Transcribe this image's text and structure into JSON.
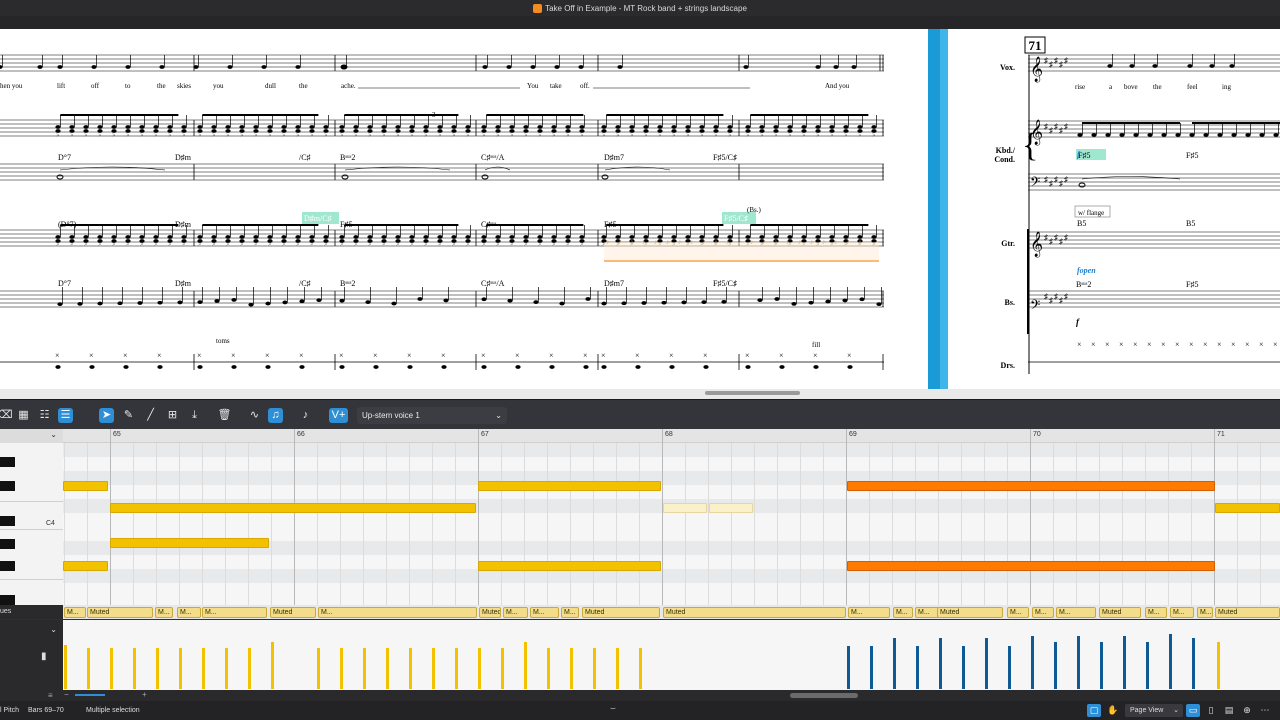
{
  "window": {
    "title": "Take Off in Example - MT Rock band + strings landscape"
  },
  "score": {
    "bar_number": "71",
    "instrument_labels": [
      "Vox.",
      "Kbd./",
      "Cond.",
      "Gtr.",
      "Bs.",
      "Drs."
    ],
    "lyrics_left": [
      "hen you",
      "lift",
      "off",
      "to",
      "the",
      "skies",
      "you",
      "dull",
      "the",
      "ache.",
      "You",
      "take",
      "off.",
      "And you"
    ],
    "lyrics_right": [
      "rise",
      "a",
      "bove",
      "the",
      "feel",
      "ing"
    ],
    "chords_kbd": [
      "D°7",
      "D♯m",
      "/C♯",
      "Bˢᵘˢ2",
      "C♯ˢᵘˢ/A",
      "D♯m7",
      "F♯5/C♯"
    ],
    "chords_gtr": [
      "(D°7)",
      "D♯m",
      "D♯m/C♯",
      "F♯5",
      "C♯ˢᵘˢ",
      "F♯5",
      "F♯5/C♯"
    ],
    "chords_bass": [
      "D°7",
      "D♯m",
      "/C♯",
      "Bˢᵘˢ2",
      "C♯ˢᵘˢ/A",
      "D♯m7",
      "F♯5/C♯"
    ],
    "chords_right": [
      "F♯5",
      "B5",
      "F♯5",
      "B5",
      "Bˢᵘˢ2",
      "F♯5"
    ],
    "annotations": {
      "toms": "toms",
      "fill": "fill",
      "bs": "(Bs.)",
      "flange": "w/ flange",
      "fopen": "fopen",
      "triplet": "3",
      "dyn": "f"
    }
  },
  "toolbar": {
    "voice_label": "Up-stem voice 1",
    "icons": [
      "eraser-icon",
      "grid-icon",
      "mixer-icon",
      "lanes-icon",
      "select-arrow-icon",
      "pencil-icon",
      "line-icon",
      "quantize-icon",
      "import-icon",
      "trash-icon",
      "waveform-icon",
      "note-icon",
      "tie-icon",
      "voice-icon"
    ]
  },
  "piano_roll": {
    "c4_label": "C4",
    "bars": [
      "65",
      "66",
      "67",
      "68",
      "69",
      "70",
      "71"
    ]
  },
  "lane": {
    "header": "ues",
    "segments": [
      "M...",
      "Muted",
      "M...",
      "M...",
      "M...",
      "Muted",
      "M...",
      "Muted",
      "M...",
      "M...",
      "M...",
      "Muted",
      "Muted",
      "M...",
      "M...",
      "M...",
      "Muted",
      "M...",
      "M...",
      "M...",
      "Muted",
      "M...",
      "M...",
      "M...",
      "Muted"
    ]
  },
  "status": {
    "pitch": "l Pitch",
    "bars": "Bars 69–70",
    "selection": "Multiple selection",
    "view": "Page View"
  },
  "colors": {
    "accent": "#2f8fd6",
    "note_yellow": "#f2c200",
    "note_orange": "#ff7a00",
    "velocity_blue": "#0e5a94",
    "chord_highlight": "#9fe8cf"
  }
}
